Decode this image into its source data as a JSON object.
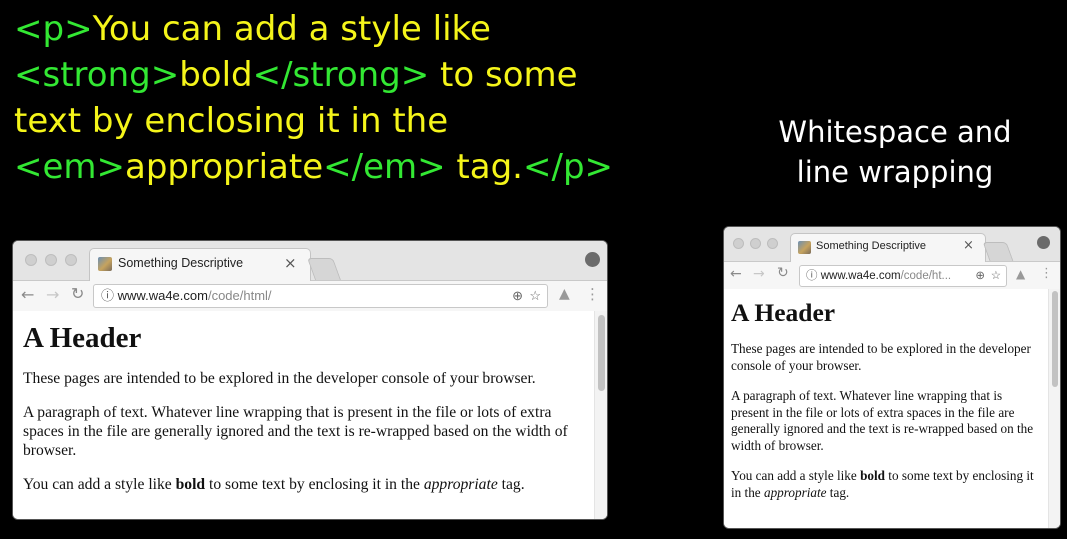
{
  "slide": {
    "code_lines": [
      [
        {
          "k": "t",
          "s": "<p>"
        },
        {
          "k": "x",
          "s": "You can add a style like"
        }
      ],
      [
        {
          "k": "t",
          "s": "<strong>"
        },
        {
          "k": "x",
          "s": "bold"
        },
        {
          "k": "t",
          "s": "</strong>"
        },
        {
          "k": "x",
          "s": " to some"
        }
      ],
      [
        {
          "k": "x",
          "s": "text by enclosing it in the"
        }
      ],
      [
        {
          "k": "t",
          "s": "<em>"
        },
        {
          "k": "x",
          "s": "appropriate"
        },
        {
          "k": "t",
          "s": "</em>"
        },
        {
          "k": "x",
          "s": " tag."
        },
        {
          "k": "t",
          "s": "</p>"
        }
      ]
    ],
    "side_title_line1": "Whitespace and",
    "side_title_line2": "line wrapping",
    "colors": {
      "tag": "#33e833",
      "text": "#f5f51a",
      "background": "#000000"
    }
  },
  "browser_large": {
    "tab_title": "Something Descriptive",
    "tab_close": "×",
    "url_host": "www.wa4e.com",
    "url_path": "/code/html/",
    "page": {
      "heading": "A Header",
      "p1": "These pages are intended to be explored in the developer console of your browser.",
      "p2": "A paragraph of text. Whatever line wrapping that is present in the file or lots of extra spaces in the file are generally ignored and the text is re-wrapped based on the width of browser.",
      "p3_before": "You can add a style like ",
      "p3_bold": "bold",
      "p3_mid": " to some text by enclosing it in the ",
      "p3_em": "appropriate",
      "p3_after": " tag."
    }
  },
  "browser_small": {
    "tab_title": "Something Descriptive",
    "tab_close": "×",
    "url_host": "www.wa4e.com",
    "url_path": "/code/ht...",
    "page": {
      "heading": "A Header",
      "p1": "These pages are intended to be explored in the developer console of your browser.",
      "p2": "A paragraph of text. Whatever line wrapping that is present in the file or lots of extra spaces in the file are generally ignored and the text is re-wrapped based on the width of browser.",
      "p3_before": "You can add a style like ",
      "p3_bold": "bold",
      "p3_mid": " to some text by enclosing it in the ",
      "p3_em": "appropriate",
      "p3_after": " tag."
    }
  },
  "icons": {
    "back": "arrow-left-icon",
    "forward": "arrow-right-icon",
    "reload": "reload-icon",
    "info": "info-icon",
    "zoom": "zoom-icon",
    "star": "star-icon",
    "extension": "extension-icon",
    "menu": "kebab-menu-icon",
    "profile": "profile-icon"
  }
}
